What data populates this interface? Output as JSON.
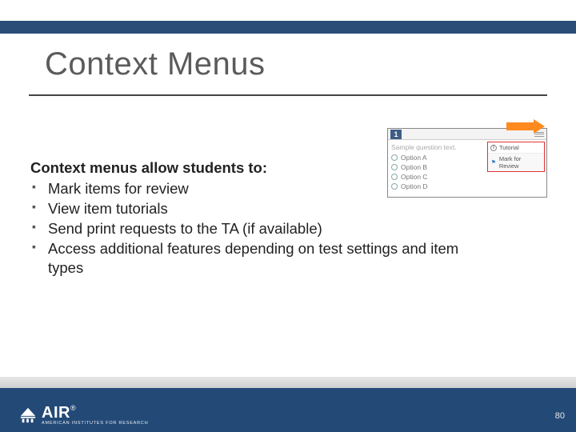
{
  "title": "Context Menus",
  "lead": "Context menus allow students to:",
  "bullets": [
    "Mark items for review",
    "View item tutorials",
    "Send print requests to the TA (if available)",
    "Access additional features depending on test settings and item types"
  ],
  "mini": {
    "number": "1",
    "question": "Sample question text.",
    "options": [
      "Option A",
      "Option B",
      "Option C",
      "Option D"
    ],
    "menu": {
      "tutorial": "Tutorial",
      "mark": "Mark for Review"
    }
  },
  "footer": {
    "logo_text": "AIR",
    "logo_sub": "AMERICAN INSTITUTES FOR RESEARCH",
    "reg": "®",
    "page": "80"
  }
}
